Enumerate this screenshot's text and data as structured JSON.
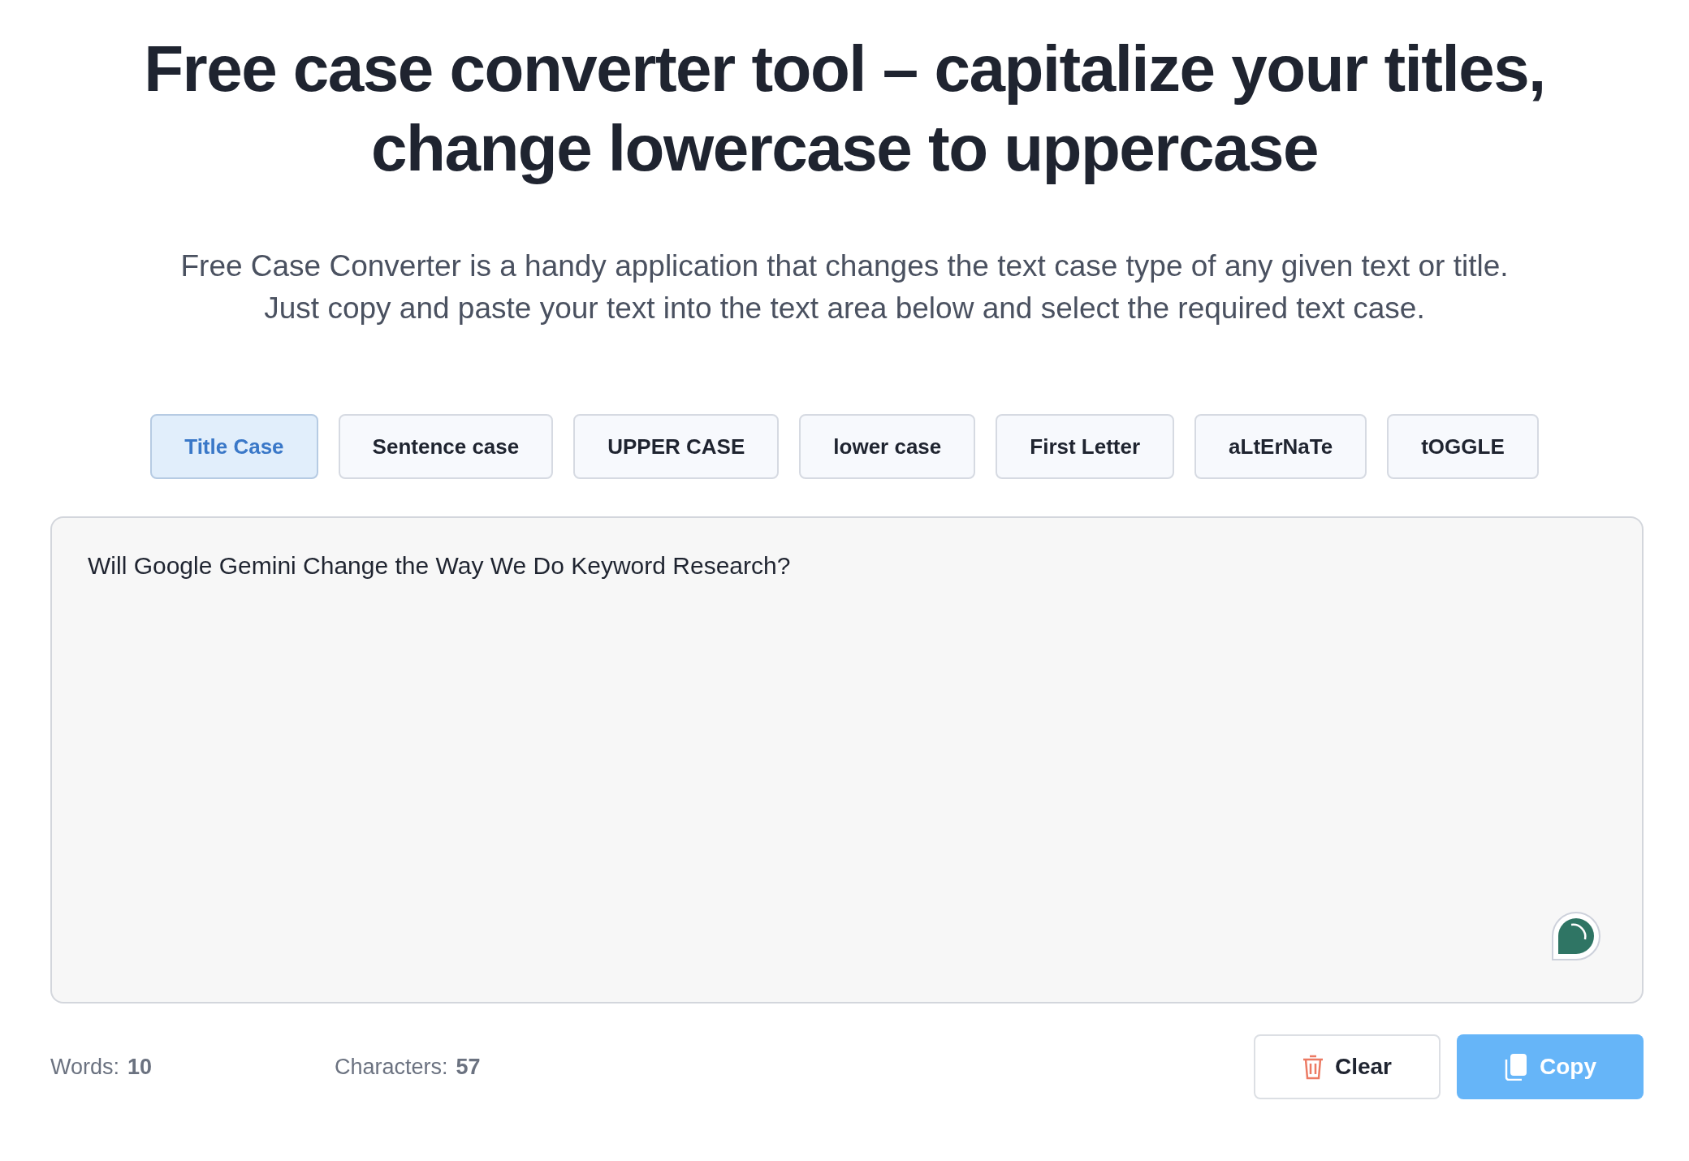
{
  "heading": {
    "lines": [
      "Free case converter tool – capitalize your titles,",
      "change lowercase to uppercase"
    ]
  },
  "intro": {
    "lines": [
      "Free Case Converter is a handy application that changes the text case type of any given text or title.",
      "Just copy and paste your text into the text area below and select the required text case."
    ]
  },
  "case_buttons": [
    {
      "label": "Title Case",
      "selected": true
    },
    {
      "label": "Sentence case",
      "selected": false
    },
    {
      "label": "UPPER CASE",
      "selected": false
    },
    {
      "label": "lower case",
      "selected": false
    },
    {
      "label": "First Letter",
      "selected": false
    },
    {
      "label": "aLtErNaTe",
      "selected": false
    },
    {
      "label": "tOGGLE",
      "selected": false
    }
  ],
  "editor": {
    "value": "Will Google Gemini Change the Way We Do Keyword Research?"
  },
  "stats": [
    {
      "label": "Words:",
      "value": "10"
    },
    {
      "label": "Characters:",
      "value": "57"
    }
  ],
  "actions": [
    {
      "kind": "clear",
      "label": "Clear"
    },
    {
      "kind": "copy",
      "label": "Copy"
    }
  ]
}
